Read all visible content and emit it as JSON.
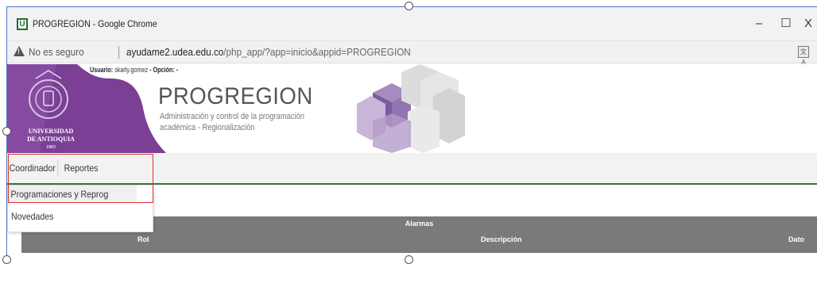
{
  "window": {
    "title": "PROGREGION - Google Chrome",
    "app_icon": "U",
    "minimize": "–",
    "maximize": "☐",
    "close": "X"
  },
  "address": {
    "security": "No es seguro",
    "url_host": "ayudame2.udea.edu.co",
    "url_path": "/php_app/?app=inicio&appid=PROGREGION"
  },
  "header": {
    "usuario_label": "Usuario:",
    "usuario_value": "skarly.gomez",
    "opcion_label": "- Opción: -",
    "app_name": "PROGREGION",
    "desc_line1": "Administración y control de la programación",
    "desc_line2": "académica - Regionalización",
    "university_line1": "UNIVERSIDAD",
    "university_line2": "DE ANTIOQUIA",
    "university_year": "1803",
    "brand_purple": "#7b3f96"
  },
  "menu": {
    "tabs": [
      "Coordinador",
      "Reportes"
    ],
    "dropdown": [
      "Programaciones y Reprog",
      "Novedades"
    ],
    "accent_green": "#2c7a3c",
    "highlight_red": "#e03030"
  },
  "alarms": {
    "title": "Alarmas",
    "columns": [
      "Rol",
      "Descripción",
      "Dato"
    ]
  }
}
